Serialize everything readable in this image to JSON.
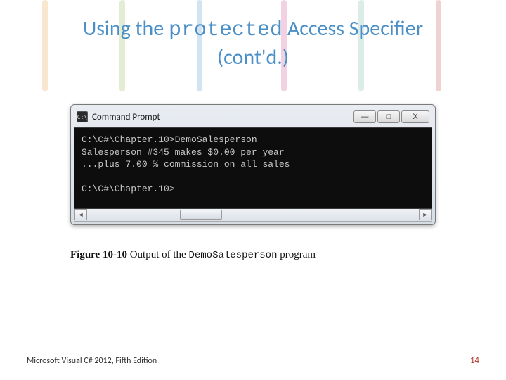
{
  "title": {
    "pre": "Using the ",
    "code": "protected",
    "post": " Access Specifier",
    "line2": "(cont'd.)"
  },
  "window": {
    "icon_text": "C:\\",
    "title": "Command Prompt",
    "min": "—",
    "max": "□",
    "close": "X"
  },
  "console": {
    "lines": [
      "C:\\C#\\Chapter.10>DemoSalesperson",
      "Salesperson #345 makes $0.00 per year",
      "...plus 7.00 % commission on all sales",
      "",
      "C:\\C#\\Chapter.10>"
    ]
  },
  "scroll": {
    "left": "◄",
    "right": "►"
  },
  "caption": {
    "label": "Figure 10-10",
    "text_pre": "   Output of the ",
    "code": "DemoSalesperson",
    "text_post": " program"
  },
  "footer": {
    "left": "Microsoft Visual C# 2012, Fifth Edition",
    "right": "14"
  }
}
